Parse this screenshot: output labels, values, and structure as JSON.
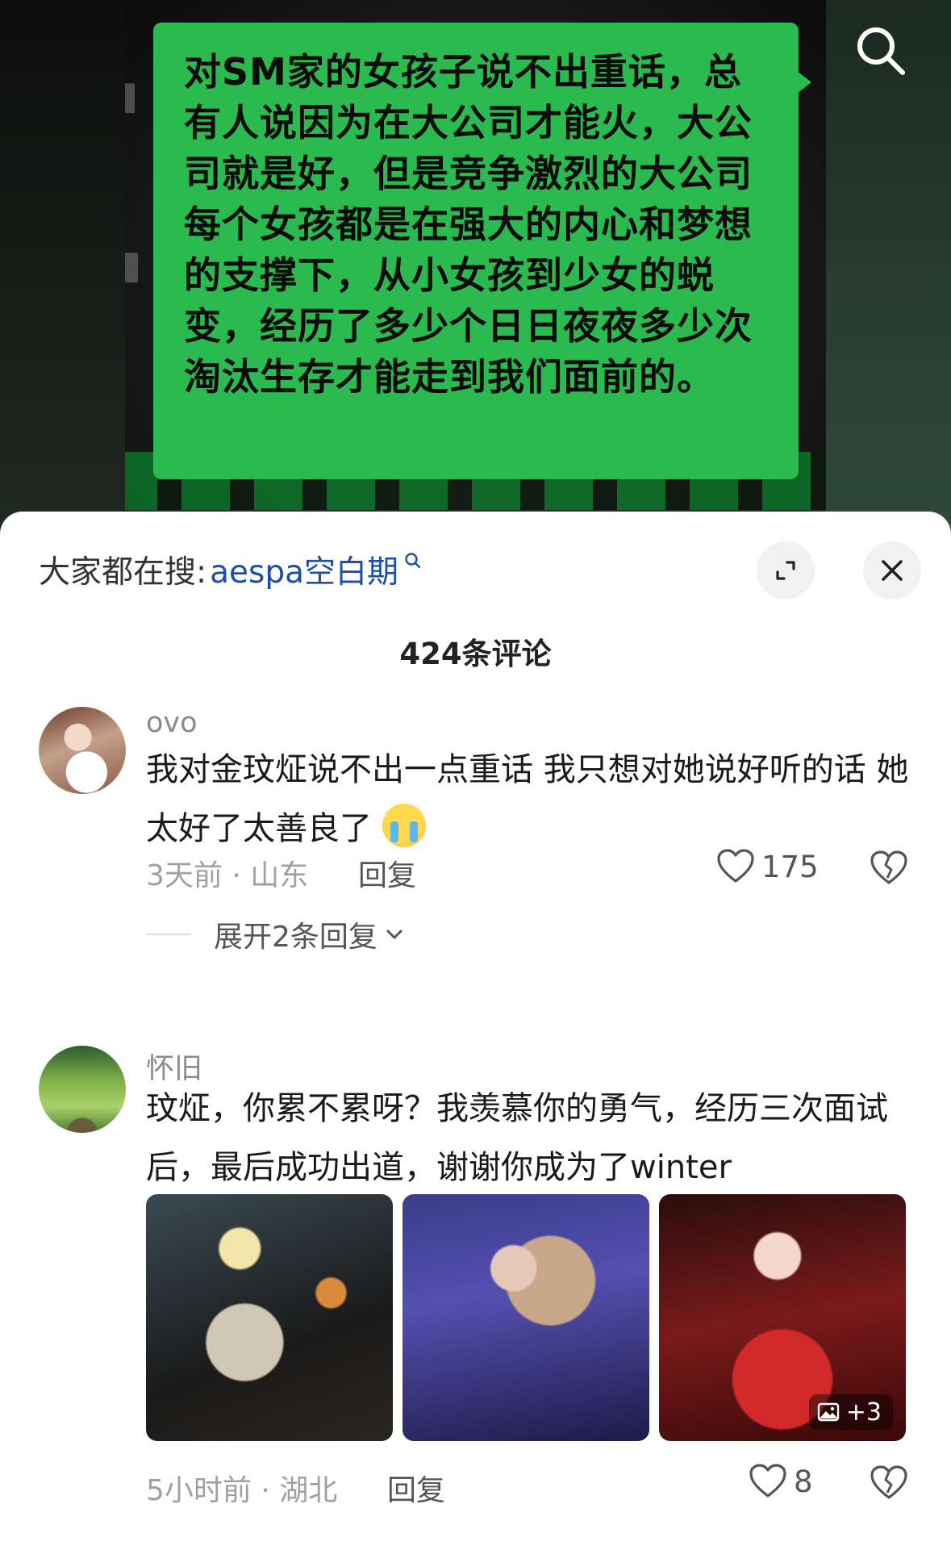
{
  "video": {
    "bubble_text": "对SM家的女孩子说不出重话，总有人说因为在大公司才能火，大公司就是好，但是竞争激烈的大公司每个女孩都是在强大的内心和梦想的支撑下，从小女孩到少女的蜕变，经历了多少个日日夜夜多少次淘汰生存才能走到我们面前的。",
    "bubble_color": "#2aba4f",
    "search_icon": "search-icon"
  },
  "sheet": {
    "search_hint_label": "大家都在搜:",
    "search_hint_keyword": "aespa空白期",
    "comment_count": "424条评论",
    "expand_icon": "expand-icon",
    "close_icon": "close-icon"
  },
  "comments": [
    {
      "username": "ovo",
      "text": "我对金玟炡说不出一点重话 我只想对她说好听的话 她太好了太善良了",
      "emoji": "loudly-crying-face",
      "meta": "3天前 · 山东",
      "reply_label": "回复",
      "likes": "175",
      "expand_replies": "展开2条回复"
    },
    {
      "username": "怀旧",
      "text": "玟炡，你累不累呀？我羡慕你的勇气，经历三次面试后，最后成功出道，谢谢你成为了winter",
      "meta": "5小时前 · 湖北",
      "reply_label": "回复",
      "likes": "8",
      "photo_more": "+3"
    }
  ],
  "colors": {
    "link": "#1d4fa6",
    "muted": "#a0a0a0"
  }
}
